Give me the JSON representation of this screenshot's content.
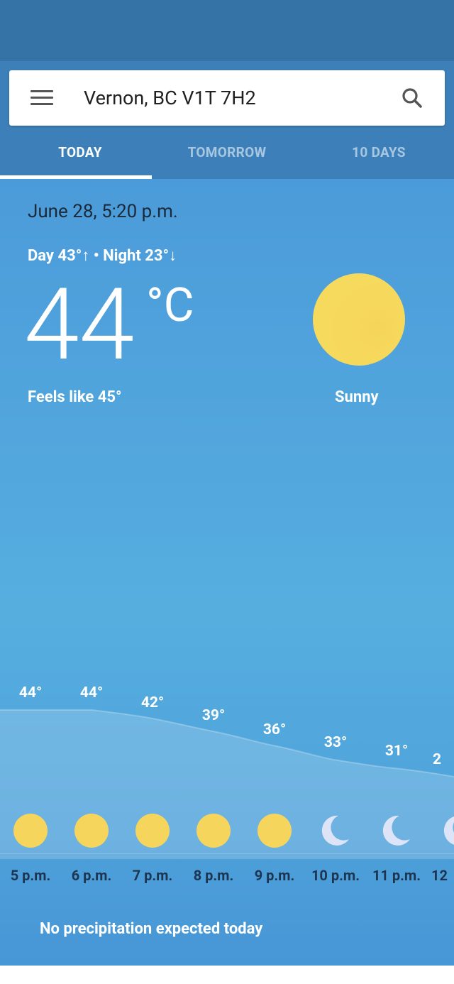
{
  "search": {
    "location": "Vernon, BC V1T 7H2"
  },
  "tabs": [
    {
      "label": "TODAY"
    },
    {
      "label": "TOMORROW"
    },
    {
      "label": "10 DAYS"
    }
  ],
  "current": {
    "datetime": "June 28, 5:20 p.m.",
    "day_night": "Day 43°↑ • Night 23°↓",
    "temperature": "44",
    "unit": "°C",
    "feels_like": "Feels like 45°",
    "condition": "Sunny",
    "condition_icon": "sun-icon"
  },
  "hourly": [
    {
      "time": "5 p.m.",
      "temp": "44°",
      "icon": "sun-icon"
    },
    {
      "time": "6 p.m.",
      "temp": "44°",
      "icon": "sun-icon"
    },
    {
      "time": "7 p.m.",
      "temp": "42°",
      "icon": "sun-icon"
    },
    {
      "time": "8 p.m.",
      "temp": "39°",
      "icon": "sun-icon"
    },
    {
      "time": "9 p.m.",
      "temp": "36°",
      "icon": "sun-icon"
    },
    {
      "time": "10 p.m.",
      "temp": "33°",
      "icon": "moon-icon"
    },
    {
      "time": "11 p.m.",
      "temp": "31°",
      "icon": "moon-icon"
    },
    {
      "time": "12",
      "temp": "2",
      "icon": "moon-icon"
    }
  ],
  "precipitation": "No precipitation expected today",
  "colors": {
    "header": "#3d80b9",
    "status_bar": "#3573a6",
    "sun": "#f6d55c",
    "moon": "#dde4f7"
  }
}
